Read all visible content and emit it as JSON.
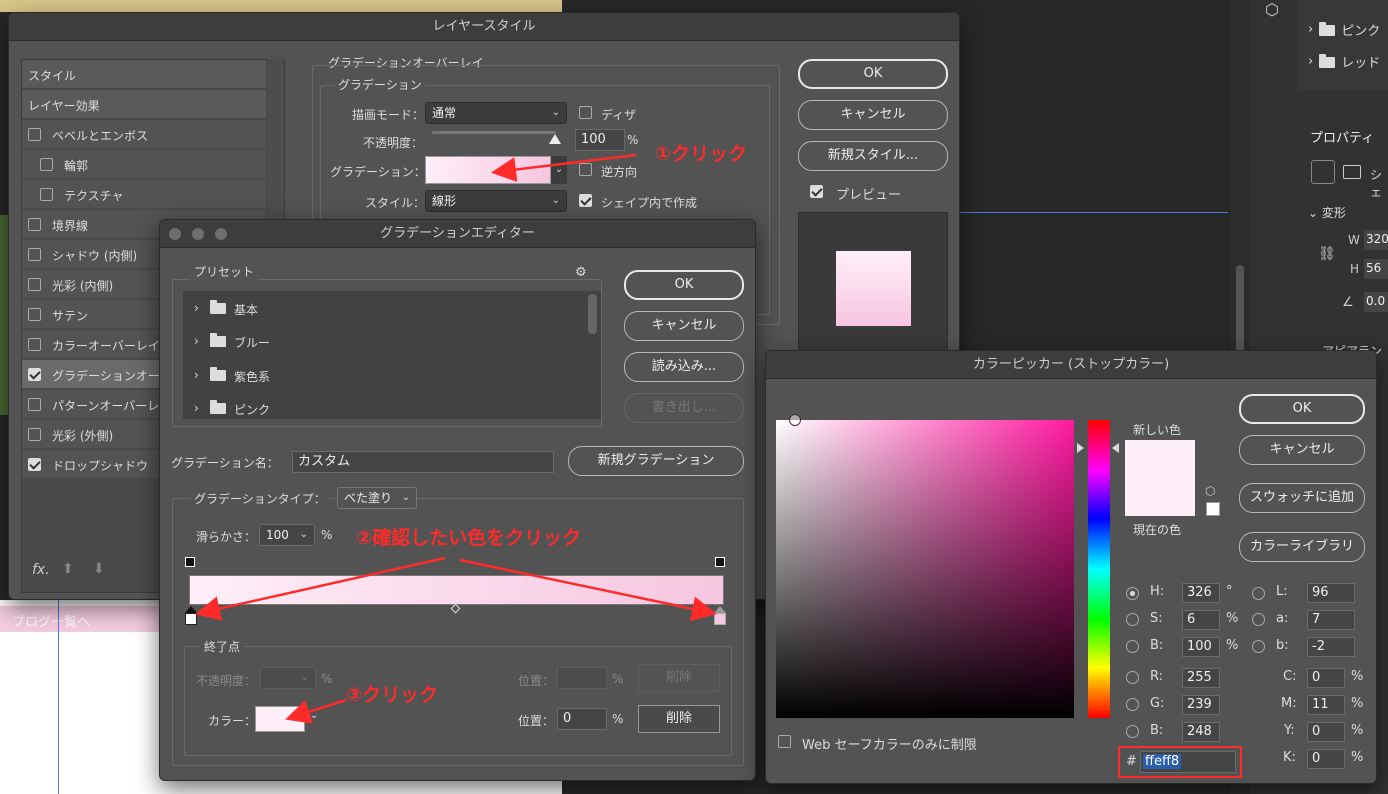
{
  "layer_style": {
    "title": "レイヤースタイル",
    "left_items": [
      {
        "label": "スタイル",
        "checkbox": null
      },
      {
        "label": "レイヤー効果",
        "checkbox": null
      },
      {
        "label": "ベベルとエンボス",
        "checkbox": false
      },
      {
        "label": "輪郭",
        "checkbox": false
      },
      {
        "label": "テクスチャ",
        "checkbox": false
      },
      {
        "label": "境界線",
        "checkbox": false
      },
      {
        "label": "シャドウ (内側)",
        "checkbox": false
      },
      {
        "label": "光彩 (内側)",
        "checkbox": false
      },
      {
        "label": "サテン",
        "checkbox": false
      },
      {
        "label": "カラーオーバーレイ",
        "checkbox": false
      },
      {
        "label": "グラデーションオーバーレイ",
        "checkbox": true
      },
      {
        "label": "パターンオーバーレイ",
        "checkbox": false
      },
      {
        "label": "光彩 (外側)",
        "checkbox": false
      },
      {
        "label": "ドロップシャドウ",
        "checkbox": true
      }
    ],
    "fx_label": "fx.",
    "section_title": "グラデーションオーバーレイ",
    "sub_title": "グラデーション",
    "blend_mode_label": "描画モード：",
    "blend_mode_value": "通常",
    "dither_label": "ディザ",
    "opacity_label": "不透明度：",
    "opacity_value": "100",
    "opacity_unit": "%",
    "gradient_label": "グラデーション：",
    "reverse_label": "逆方向",
    "style_label": "スタイル：",
    "style_value": "線形",
    "align_label": "シェイプ内で作成",
    "ok": "OK",
    "cancel": "キャンセル",
    "new_style": "新規スタイル...",
    "preview_label": "プレビュー"
  },
  "gradient_editor": {
    "title": "グラデーションエディター",
    "presets_label": "プリセット",
    "presets": [
      "基本",
      "ブルー",
      "紫色系",
      "ピンク"
    ],
    "ok": "OK",
    "cancel": "キャンセル",
    "load": "読み込み...",
    "export": "書き出し...",
    "name_label": "グラデーション名：",
    "name_value": "カスタム",
    "new_gradient": "新規グラデーション",
    "type_label": "グラデーションタイプ：",
    "type_value": "べた塗り",
    "smooth_label": "滑らかさ：",
    "smooth_value": "100",
    "smooth_unit": "%",
    "stops_title": "終了点",
    "stop_opacity_label": "不透明度：",
    "stop_opacity_unit": "%",
    "stop_location_label": "位置：",
    "stop_location_unit": "%",
    "delete": "削除",
    "color_label": "カラー：",
    "color_location_label": "位置：",
    "color_location_value": "0",
    "color_location_unit": "%",
    "delete2": "削除"
  },
  "color_picker": {
    "title": "カラーピッカー (ストップカラー)",
    "ok": "OK",
    "cancel": "キャンセル",
    "add_swatch": "スウォッチに追加",
    "libraries": "カラーライブラリ",
    "new_label": "新しい色",
    "current_label": "現在の色",
    "web_only": "Web セーフカラーのみに制限",
    "H": "326",
    "H_unit": "°",
    "S": "6",
    "S_unit": "%",
    "B": "100",
    "B_unit": "%",
    "R": "255",
    "G": "239",
    "Bv": "248",
    "L": "96",
    "a": "7",
    "b": "-2",
    "C": "0",
    "M": "11",
    "Y": "0",
    "K": "0",
    "hex_prefix": "#",
    "hex": "ffeff8",
    "lbl_H": "H:",
    "lbl_S": "S:",
    "lbl_B": "B:",
    "lbl_R": "R:",
    "lbl_G": "G:",
    "lbl_Bv": "B:",
    "lbl_L": "L:",
    "lbl_a": "a:",
    "lbl_b": "b:",
    "lbl_C": "C:",
    "lbl_M": "M:",
    "lbl_Y": "Y:",
    "lbl_K": "K:",
    "pct": "%"
  },
  "right_panel": {
    "layers": [
      "ピンク",
      "レッド"
    ],
    "properties_tab": "プロパティ",
    "transform": "変形",
    "w_label": "W",
    "w_value": "320",
    "h_label": "H",
    "h_value": "56",
    "angle_value": "0.0",
    "appearance": "アピアランス",
    "shape_tab": "シェ"
  },
  "background": {
    "blog_link": "ブログ一覧へ"
  },
  "annotations": {
    "a1": "①クリック",
    "a2": "②確認したい色をクリック",
    "a3": "③クリック"
  },
  "colors": {
    "accent_red": "#ff2a2a",
    "gradient_start": "#ffeff8",
    "gradient_end": "#f7c6e0",
    "hex_highlight": "#2a5ea8"
  }
}
